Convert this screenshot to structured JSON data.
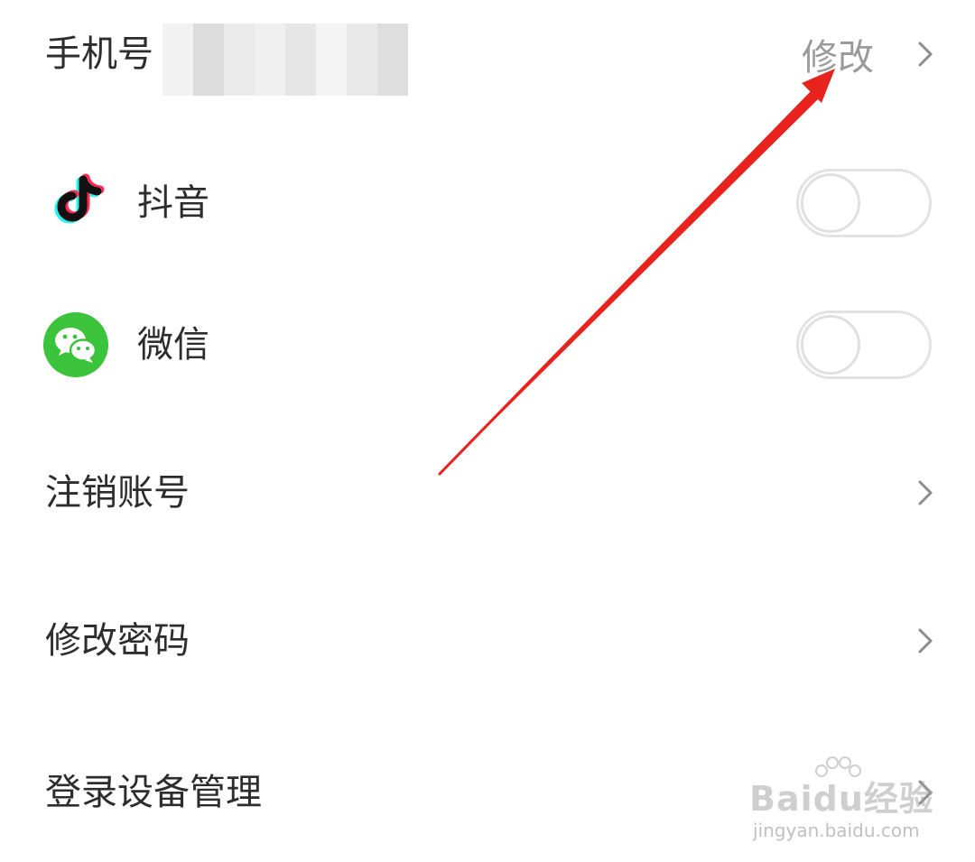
{
  "settings": {
    "phone": {
      "label": "手机号",
      "action": "修改"
    },
    "douyin": {
      "label": "抖音",
      "icon": "douyin-icon",
      "enabled": false
    },
    "wechat": {
      "label": "微信",
      "icon": "wechat-icon",
      "enabled": false
    },
    "close_account": {
      "label": "注销账号"
    },
    "change_password": {
      "label": "修改密码"
    },
    "device_management": {
      "label": "登录设备管理"
    }
  },
  "watermark": {
    "logo": "Baidu经验",
    "url": "jingyan.baidu.com"
  },
  "colors": {
    "annotation_arrow": "#e8231e",
    "wechat_green": "#3bc43b",
    "text_primary": "#2d2d2d",
    "text_secondary": "#9a9a9a"
  }
}
